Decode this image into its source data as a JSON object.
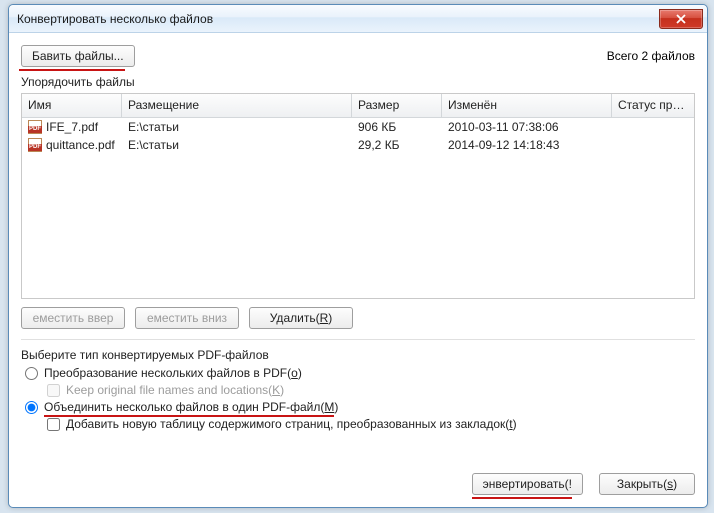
{
  "window": {
    "title": "Конвертировать несколько файлов"
  },
  "top": {
    "add_files_label": "Бавить файлы...",
    "total_label": "Всего 2 файлов"
  },
  "section": {
    "arrange_label": "Упорядочить файлы"
  },
  "columns": {
    "name": "Имя",
    "location": "Размещение",
    "size": "Размер",
    "modified": "Изменён",
    "status": "Статус преоб..."
  },
  "files": [
    {
      "name": "IFE_7.pdf",
      "location": "E:\\статьи",
      "size": "906 КБ",
      "modified": "2010-03-11 07:38:06"
    },
    {
      "name": "quittance.pdf",
      "location": "E:\\статьи",
      "size": "29,2 КБ",
      "modified": "2014-09-12 14:18:43"
    }
  ],
  "actions": {
    "move_up": "еместить ввер",
    "move_down": "еместить вниз",
    "delete_label": "Удалить(",
    "delete_hotkey": "R",
    "delete_close": ")"
  },
  "options": {
    "title": "Выберите тип конвертируемых PDF-файлов",
    "convert_many_label": "Преобразование нескольких файлов в PDF(",
    "convert_many_hotkey": "o",
    "convert_many_close": ")",
    "keep_names_label": "Keep original file names and locations(",
    "keep_names_hotkey": "K",
    "keep_names_close": ")",
    "merge_label": "Объединить несколько файлов в один PDF-файл(",
    "merge_hotkey": "M",
    "merge_close": ")",
    "add_toc_label": "Добавить новую таблицу содержимого страниц, преобразованных из закладок(",
    "add_toc_hotkey": "t",
    "add_toc_close": ")"
  },
  "footer": {
    "convert_label": "энвертировать(!",
    "close_label": "Закрыть(",
    "close_hotkey": "s",
    "close_close": ")"
  }
}
